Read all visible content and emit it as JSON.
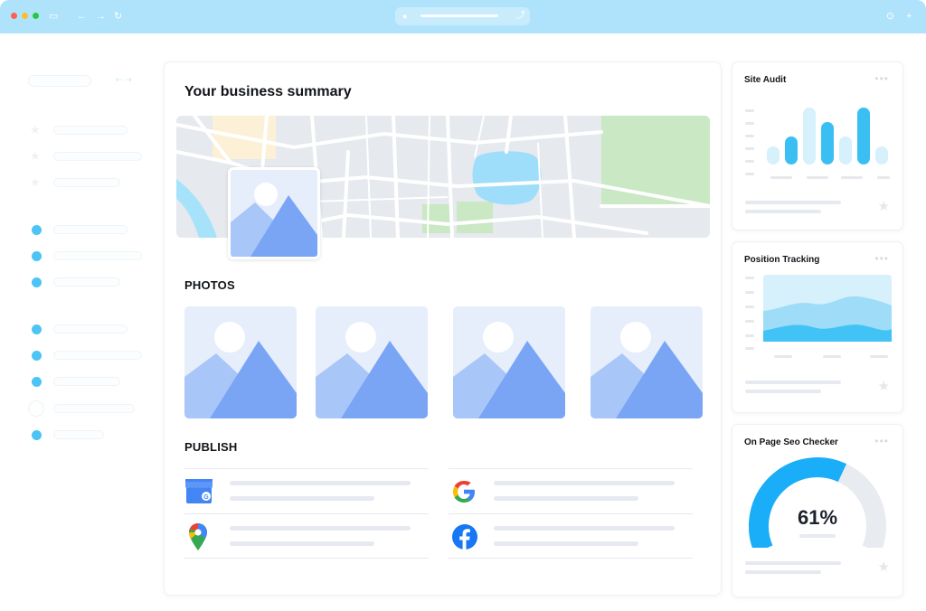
{
  "main": {
    "title": "Your business summary",
    "photos_title": "PHOTOS",
    "publish_title": "PUBLISH"
  },
  "widgets": {
    "site_audit": {
      "title": "Site Audit",
      "bars": [
        0.22,
        0.34,
        0.7,
        0.52,
        0.35,
        0.7,
        0.22
      ]
    },
    "position_tracking": {
      "title": "Position Tracking"
    },
    "seo_checker": {
      "title": "On Page Seo Checker",
      "value": "61%",
      "fraction": 0.61
    }
  },
  "icons": {
    "publish": [
      "google-my-business-icon",
      "google-icon",
      "google-maps-icon",
      "facebook-icon"
    ]
  },
  "colors": {
    "titlebar": "#aee3fb",
    "accent": "#3bbff3",
    "accent_light": "#d6f0fc",
    "gauge_track": "#e8ebef",
    "gauge_fill": "#1aaef8"
  }
}
